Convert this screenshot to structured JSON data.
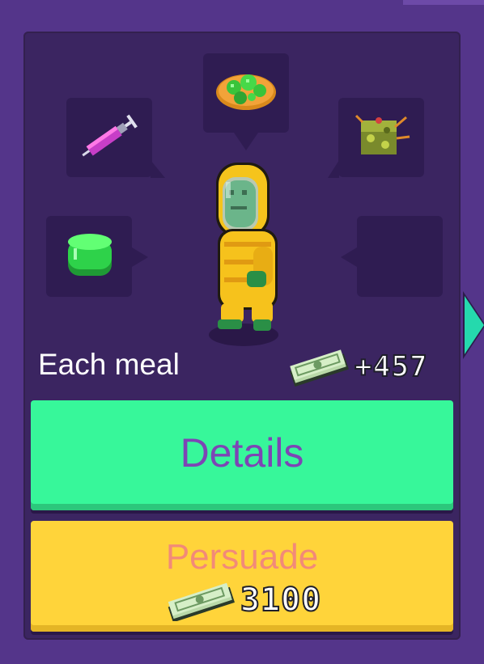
{
  "labels": {
    "each_meal": "Each meal",
    "income": "+457",
    "details": "Details",
    "persuade": "Persuade",
    "cost": "3100"
  },
  "ingredients": [
    {
      "slot": "top",
      "icon": "pizza-icon"
    },
    {
      "slot": "top-left",
      "icon": "syringe-icon"
    },
    {
      "slot": "top-right",
      "icon": "virus-block-icon"
    },
    {
      "slot": "bottom-left",
      "icon": "green-jelly-icon"
    },
    {
      "slot": "bottom-right",
      "icon": "empty-slot"
    }
  ],
  "colors": {
    "panel": "#3b2561",
    "details_button": "#37f79a",
    "details_text": "#7d45b5",
    "persuade_button": "#ffd43a",
    "persuade_text": "#f28a78",
    "arrow": "#25d9ad"
  }
}
